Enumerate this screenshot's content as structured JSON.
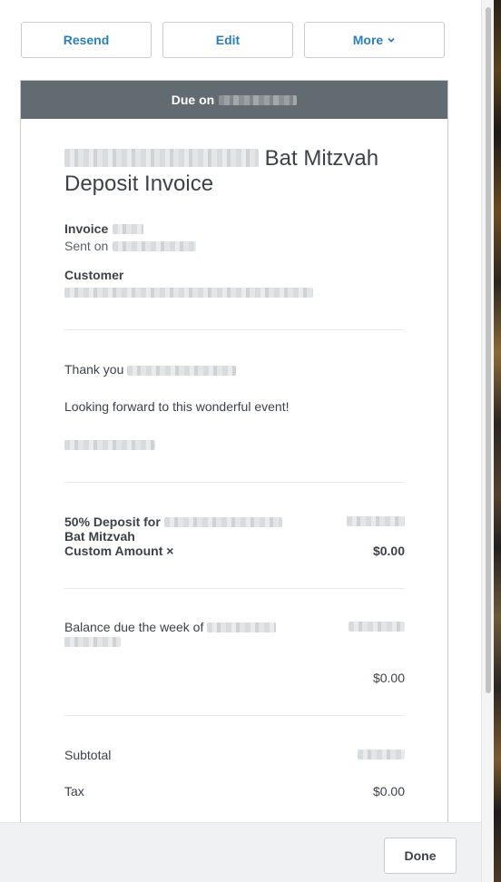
{
  "toolbar": {
    "resend_label": "Resend",
    "edit_label": "Edit",
    "more_label": "More"
  },
  "invoice": {
    "due_prefix": "Due on",
    "title_suffix": "Bat Mitzvah",
    "title_line2": "Deposit Invoice",
    "invoice_label": "Invoice",
    "sent_label": "Sent on",
    "customer_label": "Customer",
    "thank_you": "Thank you",
    "message": "Looking forward to this wonderful event!",
    "line_items": [
      {
        "title_prefix": "50% Deposit for",
        "title_line2": "Bat Mitzvah",
        "modifier": "Custom Amount ×",
        "amount": "$0.00"
      },
      {
        "title_prefix": "Balance due the week of",
        "amount": "$0.00"
      }
    ],
    "subtotal_label": "Subtotal",
    "tax_label": "Tax",
    "tax_value": "$0.00"
  },
  "footer": {
    "done_label": "Done"
  },
  "colors": {
    "accent": "#2b7fb8",
    "due_bar": "#636b72",
    "text": "#3d4249"
  }
}
